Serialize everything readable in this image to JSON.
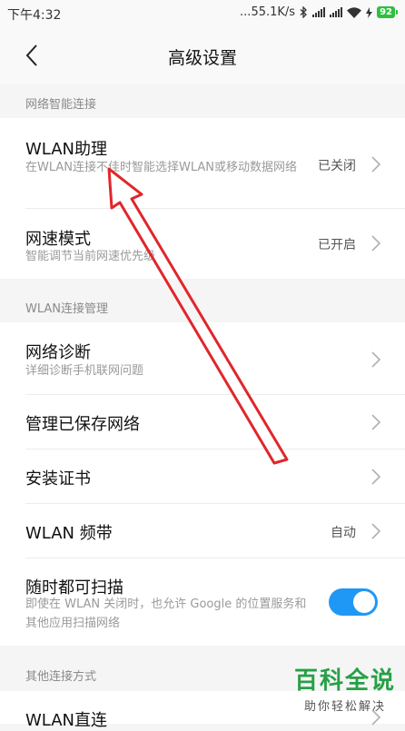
{
  "status_bar": {
    "time": "下午4:32",
    "network_speed": "...55.1K/s",
    "battery": "92",
    "icons": [
      "bluetooth-icon",
      "signal-icon",
      "signal-icon",
      "wifi-icon",
      "charging-icon",
      "battery-icon"
    ]
  },
  "header": {
    "title": "高级设置",
    "back_icon": "chevron-left-icon"
  },
  "sections": {
    "smart": {
      "label": "网络智能连接",
      "wlan_assistant": {
        "title": "WLAN助理",
        "subtitle": "在WLAN连接不佳时智能选择WLAN或移动数据网络",
        "value": "已关闭"
      },
      "speed_mode": {
        "title": "网速模式",
        "subtitle": "智能调节当前网速优先级",
        "value": "已开启"
      }
    },
    "manage": {
      "label": "WLAN连接管理",
      "diagnose": {
        "title": "网络诊断",
        "subtitle": "详细诊断手机联网问题"
      },
      "saved": {
        "title": "管理已保存网络"
      },
      "cert": {
        "title": "安装证书"
      },
      "band": {
        "title": "WLAN 频带",
        "value": "自动"
      },
      "scan": {
        "title": "随时都可扫描",
        "subtitle": "即使在 WLAN 关闭时，也允许 Google 的位置服务和其他应用扫描网络",
        "enabled": true
      }
    },
    "other": {
      "label": "其他连接方式",
      "direct": {
        "title": "WLAN直连"
      }
    }
  },
  "watermark": {
    "title": "百科全说",
    "subtitle": "助你轻松解决"
  },
  "colors": {
    "toggle_on": "#1f98f5",
    "annotation_arrow": "#e0262b",
    "watermark": "#27a046"
  }
}
